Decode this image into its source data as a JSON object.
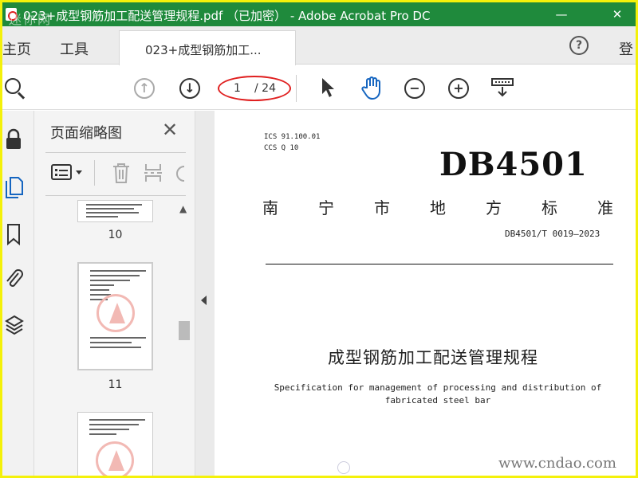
{
  "window": {
    "title": "023+成型钢筋加工配送管理规程.pdf （已加密） - Adobe Acrobat Pro DC",
    "watermark": "迷你网",
    "minimize": "—",
    "close": "✕"
  },
  "tabs": {
    "home": "主页",
    "tools": "工具",
    "document": "023+成型钢筋加工...",
    "help": "?",
    "login": "登"
  },
  "toolbar": {
    "page_current": "1",
    "page_total": "/ 24",
    "zoom_out": "−",
    "zoom_in": "+",
    "prev": "↑",
    "next": "↓"
  },
  "thumbnails": {
    "title": "页面缩略图",
    "close": "✕",
    "pages": [
      {
        "number": "10"
      },
      {
        "number": "11"
      }
    ]
  },
  "document": {
    "ics": "ICS  91.100.01",
    "ccs": "CCS  Q 10",
    "code": "DB4501",
    "issuer_chars": [
      "南",
      "宁",
      "市",
      "地",
      "方",
      "标",
      "准"
    ],
    "standard_no": "DB4501/T 0019—2023",
    "title_cn": "成型钢筋加工配送管理规程",
    "title_en_1": "Specification for management of processing and distribution of",
    "title_en_2": "fabricated steel bar",
    "watermark": "www.cndao.com"
  },
  "colors": {
    "titlebar": "#1f8a3c",
    "border_frame": "#f4f10a",
    "annotation_ellipse": "#e02020"
  }
}
